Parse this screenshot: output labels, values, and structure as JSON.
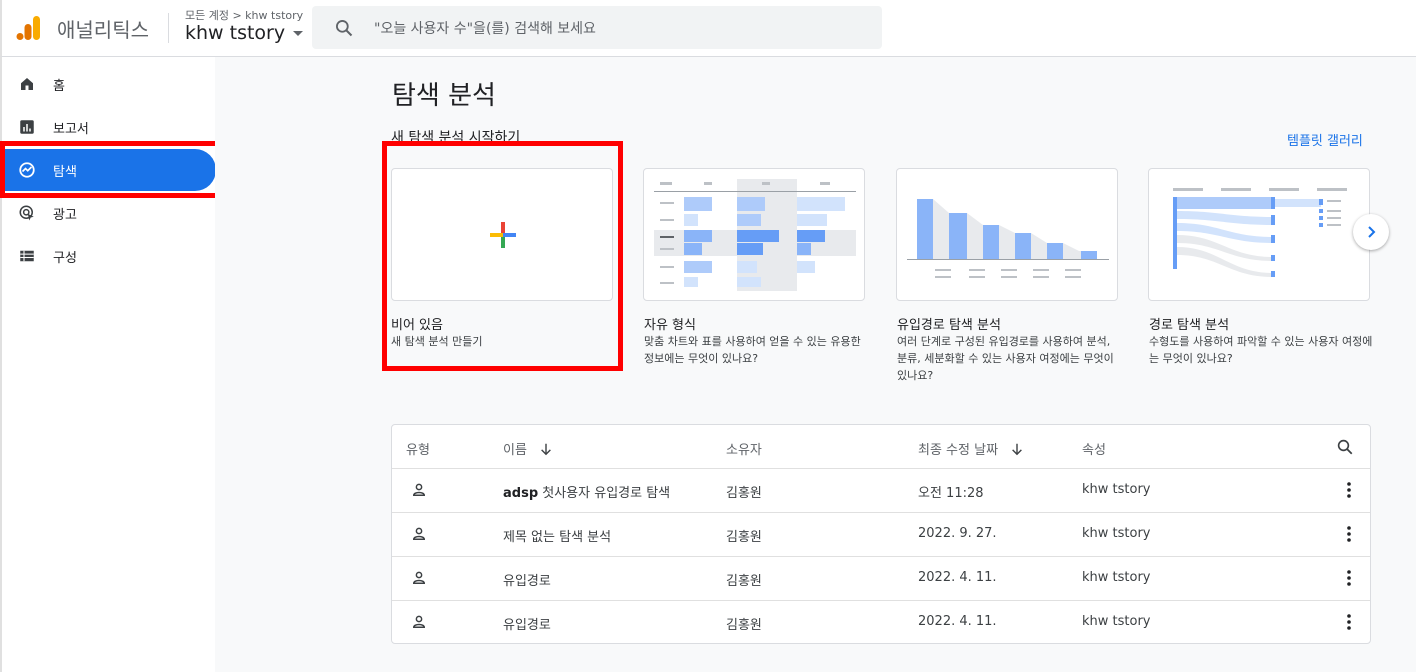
{
  "header": {
    "app_name": "애널리틱스",
    "account_breadcrumb": "모든 계정 > khw tstory",
    "account_name": "khw tstory",
    "search_placeholder": "\"오늘 사용자 수\"을(를) 검색해 보세요"
  },
  "sidebar": {
    "items": [
      {
        "label": "홈",
        "icon": "home-icon"
      },
      {
        "label": "보고서",
        "icon": "bar-chart-icon"
      },
      {
        "label": "탐색",
        "icon": "explore-icon",
        "active": true
      },
      {
        "label": "광고",
        "icon": "ads-icon"
      },
      {
        "label": "구성",
        "icon": "configure-icon"
      }
    ]
  },
  "main": {
    "title": "탐색 분석",
    "section_title": "새 탐색 분석 시작하기",
    "template_gallery_link": "템플릿 갤러리",
    "cards": [
      {
        "title": "비어 있음",
        "desc": "새 탐색 분석 만들기"
      },
      {
        "title": "자유 형식",
        "desc": "맞춤 차트와 표를 사용하여 얻을 수 있는 유용한 정보에는 무엇이 있나요?"
      },
      {
        "title": "유입경로 탐색 분석",
        "desc": "여러 단계로 구성된 유입경로를 사용하여 분석, 분류, 세분화할 수 있는 사용자 여정에는 무엇이 있나요?"
      },
      {
        "title": "경로 탐색 분석",
        "desc": "수형도를 사용하여 파악할 수 있는 사용자 여정에는 무엇이 있나요?"
      }
    ],
    "table": {
      "headers": {
        "type": "유형",
        "name": "이름",
        "owner": "소유자",
        "modified": "최종 수정 날짜",
        "property": "속성"
      },
      "rows": [
        {
          "name_bold": "adsp",
          "name": " 첫사용자 유입경로 탐색",
          "owner": "김홍원",
          "modified": "오전 11:28",
          "property": "khw tstory"
        },
        {
          "name_bold": "",
          "name": "제목 없는 탐색 분석",
          "owner": "김홍원",
          "modified": "2022. 9. 27.",
          "property": "khw tstory"
        },
        {
          "name_bold": "",
          "name": "유입경로",
          "owner": "김홍원",
          "modified": "2022. 4. 11.",
          "property": "khw tstory"
        },
        {
          "name_bold": "",
          "name": "유입경로",
          "owner": "김홍원",
          "modified": "2022. 4. 11.",
          "property": "khw tstory"
        }
      ]
    }
  },
  "colors": {
    "accent": "#1a73e8",
    "highlight": "#ff0000",
    "logo_orange": "#f9ab00",
    "logo_dark_orange": "#e37400"
  }
}
